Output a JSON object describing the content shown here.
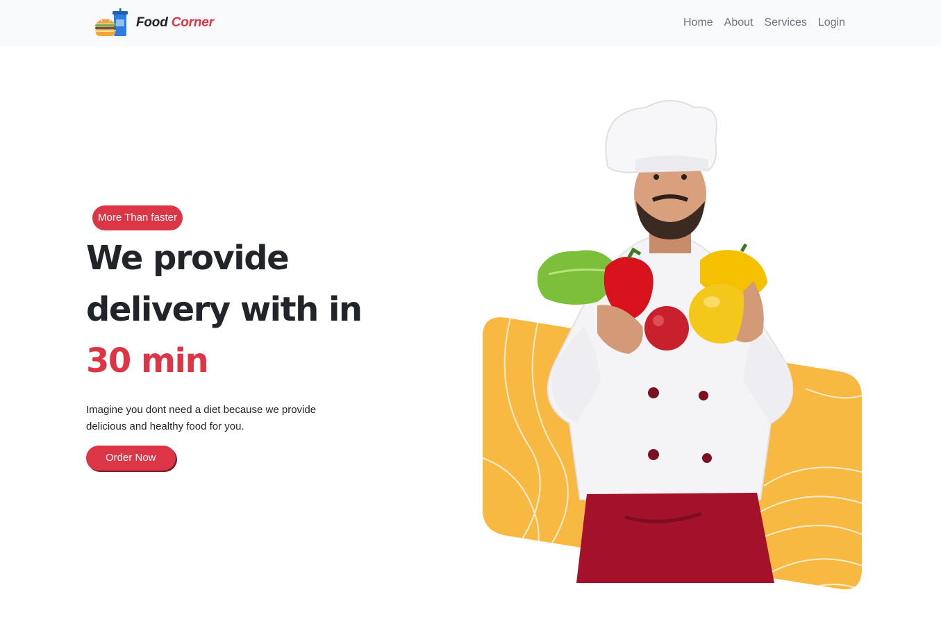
{
  "navbar": {
    "brand": {
      "word1": "Food",
      "word2": "Corner"
    },
    "links": [
      {
        "label": "Home"
      },
      {
        "label": "About"
      },
      {
        "label": "Services"
      },
      {
        "label": "Login"
      }
    ]
  },
  "hero": {
    "badge": "More Than faster",
    "headline_line1": "We provide",
    "headline_line2": "delivery with in",
    "headline_accent": "30 min",
    "description": "Imagine you dont need a diet because we provide delicious and healthy food for you.",
    "cta_label": "Order Now"
  },
  "colors": {
    "accent": "#dc3545",
    "navbar_bg": "#f8f9fa",
    "shape_yellow": "#f8b942",
    "text_dark": "#212529",
    "nav_text": "#6c757d"
  },
  "icons": {
    "logo": "burger-drink-logo-icon"
  }
}
